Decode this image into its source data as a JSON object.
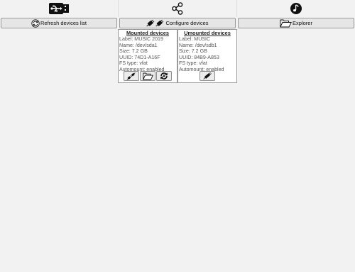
{
  "tabs": [
    {
      "icon": "usb-icon"
    },
    {
      "icon": "share-icon"
    },
    {
      "icon": "music-note-icon"
    }
  ],
  "actions": {
    "refresh_label": "Refresh devices list",
    "configure_label": "Configure devices",
    "explorer_label": "Explorer"
  },
  "mounted": {
    "title": "Mounted devices",
    "label": "Label: MUSIC 2019",
    "name": "Name: /dev/sda1",
    "size": "Size: 7.2 GB",
    "uuid": "UUID: 74D1-A16F",
    "fstype": "FS type: vfat",
    "automount": "Automount: enabled",
    "buttons": [
      "unplug-icon",
      "folder-open-icon",
      "auto-mount-toggle-icon"
    ]
  },
  "unmounted": {
    "title": "Umounted devices",
    "label": "Label: MUSIC",
    "name": "Name: /dev/sdb1",
    "size": "Size: 7.2 GB",
    "uuid": "UUID: 84B9-A853",
    "fstype": "FS type: vfat",
    "automount": "Automount: enabled",
    "buttons": [
      "plug-icon"
    ]
  },
  "colors": {
    "background": "#f2f2f2",
    "button": "#e6e6e6",
    "border": "#9a9a9a",
    "panel": "#ffffff"
  }
}
